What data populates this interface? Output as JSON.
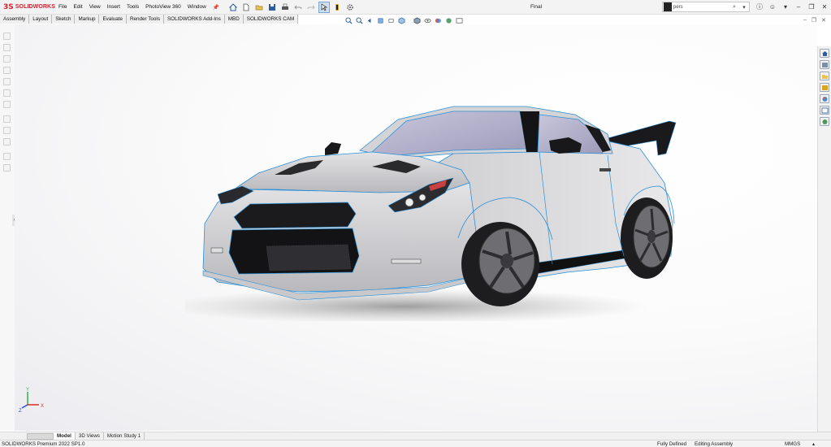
{
  "titlebar": {
    "brand_ds": "3S",
    "brand_name": "SOLIDWORKS",
    "document_title": "Final",
    "menu": [
      "File",
      "Edit",
      "View",
      "Insert",
      "Tools",
      "PhotoView 360",
      "Window"
    ]
  },
  "search": {
    "value": "pers"
  },
  "command_tabs": [
    "Assembly",
    "Layout",
    "Sketch",
    "Markup",
    "Evaluate",
    "Render Tools",
    "SOLIDWORKS Add-Ins",
    "MBD",
    "SOLIDWORKS CAM"
  ],
  "bottom_tabs": [
    "Model",
    "3D Views",
    "Motion Study 1"
  ],
  "statusbar": {
    "product": "SOLIDWORKS Premium 2022 SP1.0",
    "definition": "Fully Defined",
    "mode": "Editing Assembly",
    "units": "MMGS"
  },
  "triad": {
    "y": "Y",
    "x": "X",
    "z": "Z"
  },
  "colors": {
    "brand_red": "#d8202f",
    "selection_blue": "#2a8fd8",
    "car_body": "#d6d6d8"
  },
  "icons": [
    "home-icon",
    "new-icon",
    "open-icon",
    "save-icon",
    "print-icon",
    "undo-icon",
    "redo-icon",
    "select-icon",
    "rebuild-icon",
    "options-icon",
    "search-icon",
    "help-icon",
    "user-icon",
    "minimize-icon",
    "restore-icon",
    "close-icon"
  ]
}
